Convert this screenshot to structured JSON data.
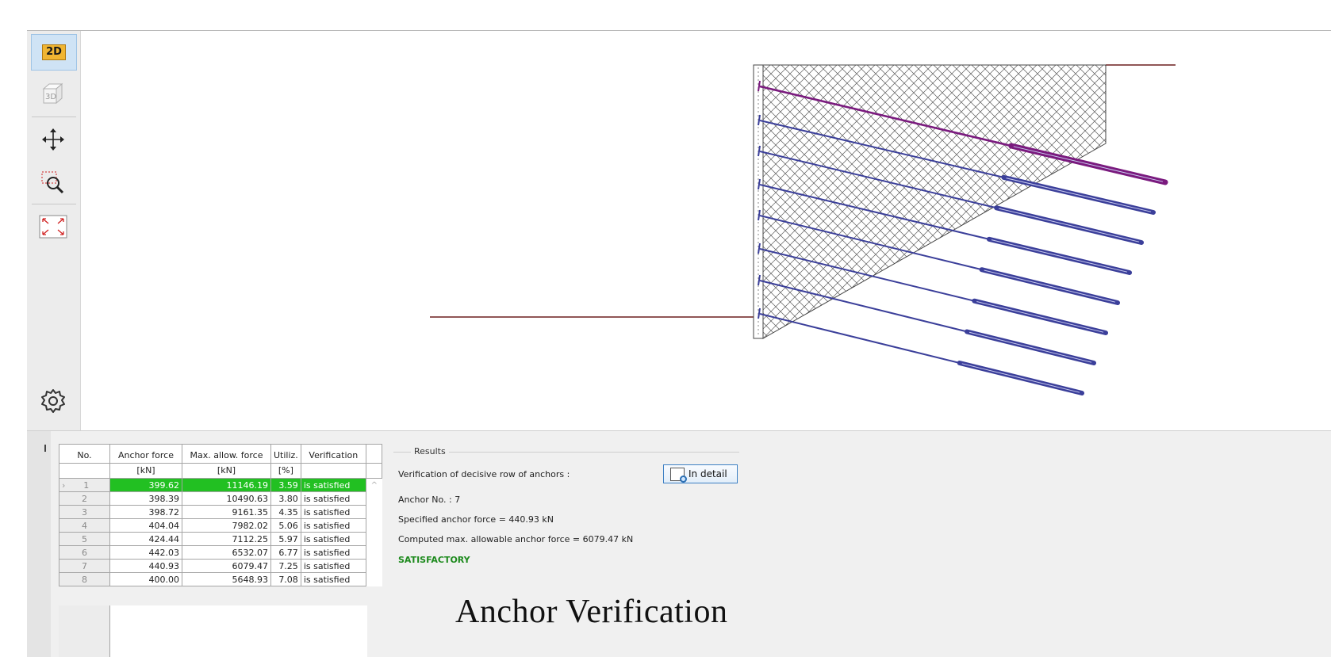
{
  "toolbar": {
    "btn_2d": "2D",
    "btn_3d": "3D",
    "icons": [
      "move-icon",
      "zoom-window-icon",
      "fit-view-icon",
      "settings-gear-icon"
    ]
  },
  "table": {
    "headers": [
      {
        "line1": "No.",
        "line2": ""
      },
      {
        "line1": "Anchor force",
        "line2": "[kN]"
      },
      {
        "line1": "Max. allow. force",
        "line2": "[kN]"
      },
      {
        "line1": "Utiliz.",
        "line2": "[%]"
      },
      {
        "line1": "Verification",
        "line2": ""
      }
    ],
    "rows": [
      {
        "no": "1",
        "force": "399.62",
        "max": "11146.19",
        "util": "3.59",
        "ver": "is satisfied"
      },
      {
        "no": "2",
        "force": "398.39",
        "max": "10490.63",
        "util": "3.80",
        "ver": "is satisfied"
      },
      {
        "no": "3",
        "force": "398.72",
        "max": "9161.35",
        "util": "4.35",
        "ver": "is satisfied"
      },
      {
        "no": "4",
        "force": "404.04",
        "max": "7982.02",
        "util": "5.06",
        "ver": "is satisfied"
      },
      {
        "no": "5",
        "force": "424.44",
        "max": "7112.25",
        "util": "5.97",
        "ver": "is satisfied"
      },
      {
        "no": "6",
        "force": "442.03",
        "max": "6532.07",
        "util": "6.77",
        "ver": "is satisfied"
      },
      {
        "no": "7",
        "force": "440.93",
        "max": "6079.47",
        "util": "7.25",
        "ver": "is satisfied"
      },
      {
        "no": "8",
        "force": "400.00",
        "max": "5648.93",
        "util": "7.08",
        "ver": "is satisfied"
      }
    ],
    "selected_row": "1",
    "row_marker": "›",
    "scroll_up": "^"
  },
  "results": {
    "legend": "Results",
    "decisive_label": "Verification of decisive row of anchors :",
    "detail_button": "In detail",
    "anchor_no": "Anchor No. : 7",
    "specified_force": "Specified anchor force = 440.93 kN",
    "computed_max": "Computed max. allowable anchor force = 6079.47 kN",
    "status": "SATISFACTORY"
  },
  "caption": "Anchor Verification",
  "colors": {
    "highlight_row": "#22c022",
    "anchor": "#3b3f9a",
    "anchor_selected": "#7a1a7e",
    "terrain": "#6b1f1f",
    "satisfactory": "#1d8a1d"
  }
}
